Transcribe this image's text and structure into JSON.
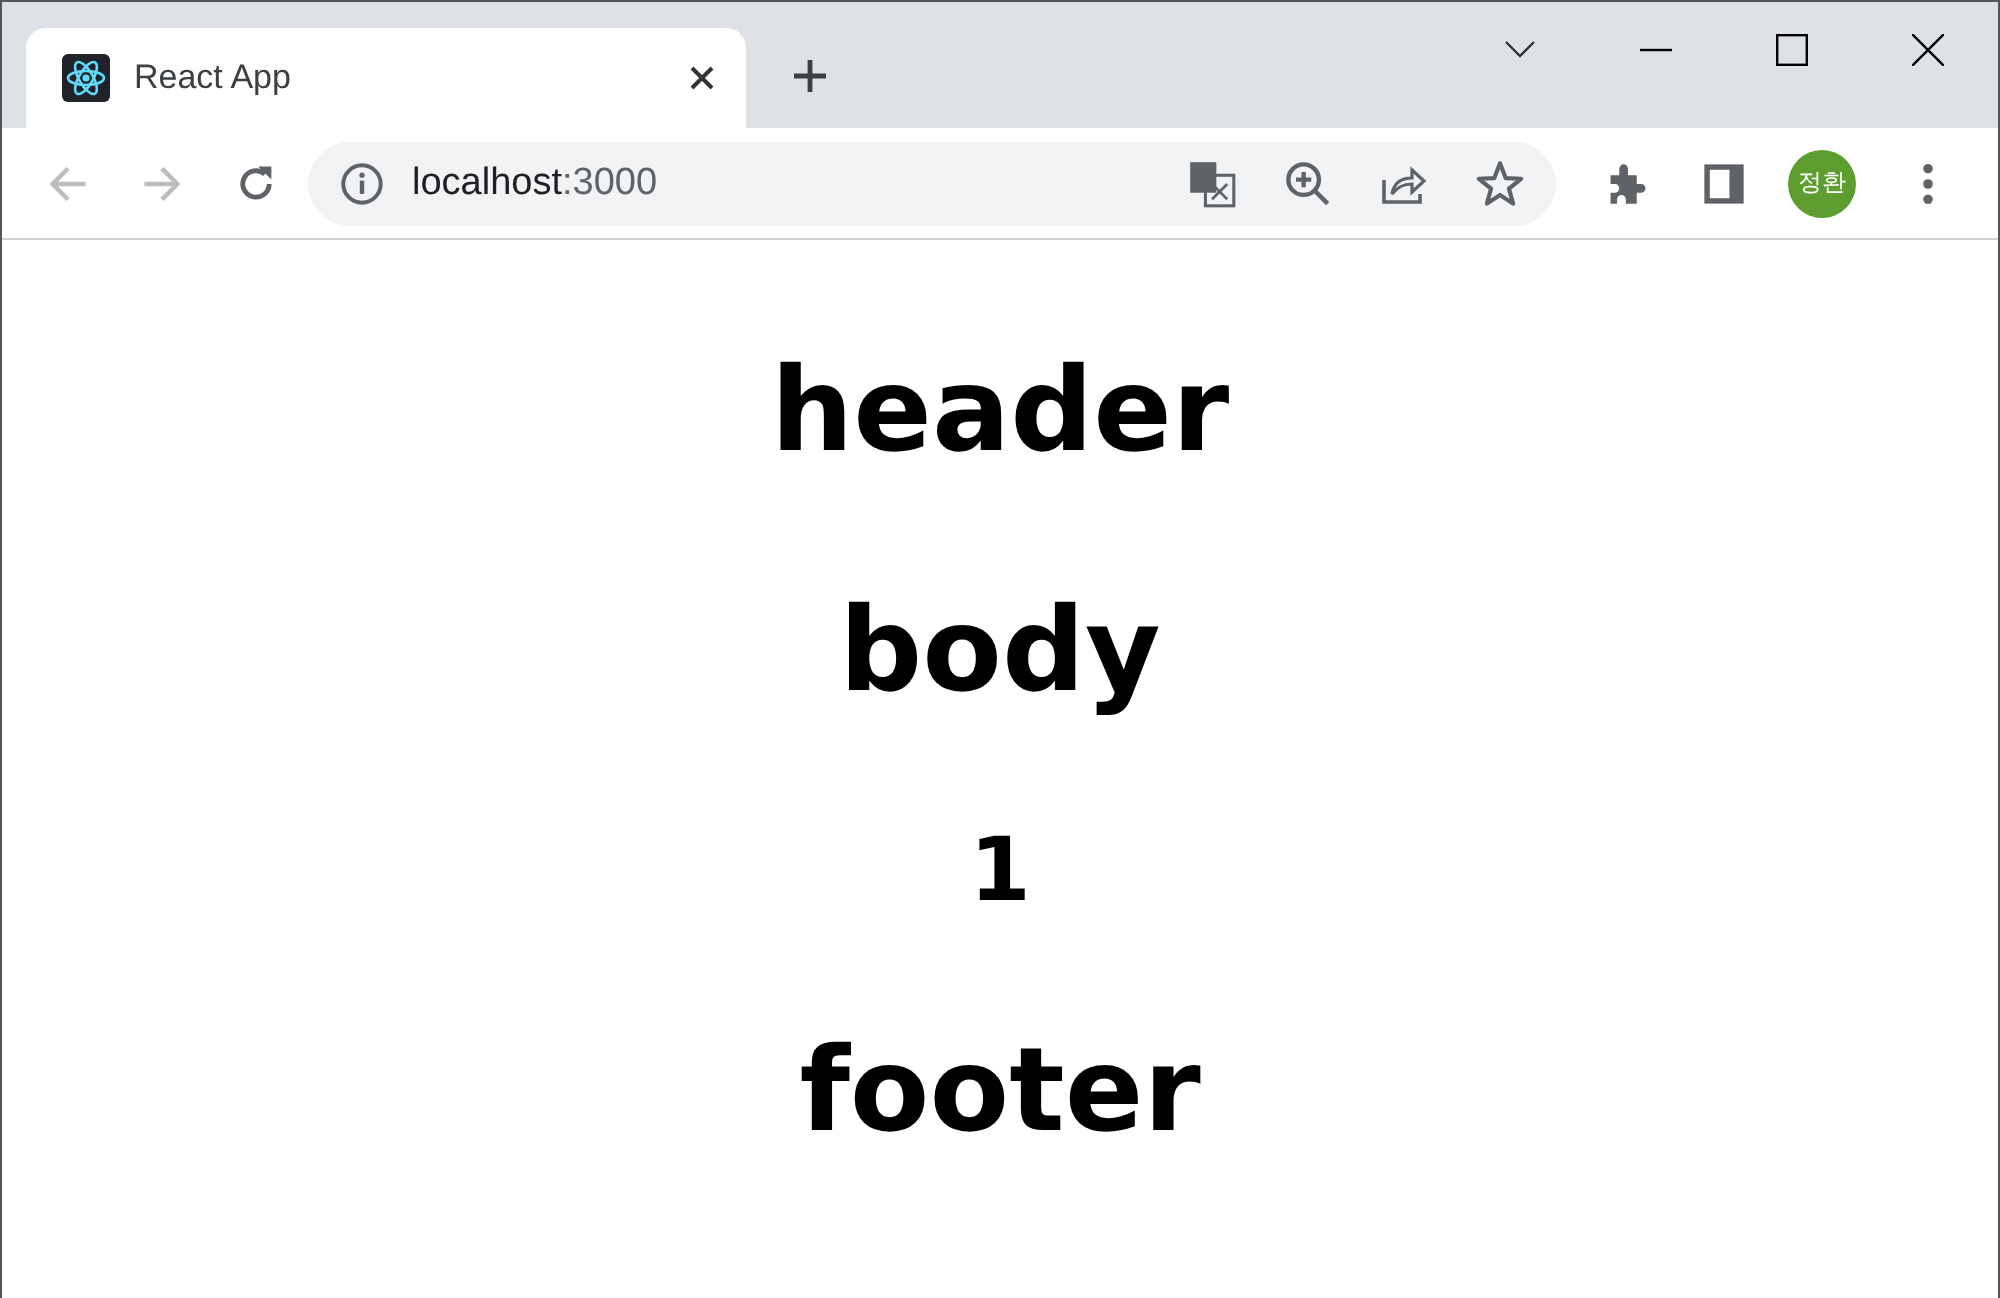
{
  "tabs": [
    {
      "title": "React App",
      "selected": true
    }
  ],
  "toolbar": {
    "back": {
      "disabled": true
    },
    "forward": {
      "disabled": true
    },
    "address": {
      "host": "localhost",
      "port": ":3000"
    },
    "profile": "정환"
  },
  "page": [
    {
      "kind": "heading",
      "text": "header"
    },
    {
      "kind": "heading",
      "text": "body"
    },
    {
      "kind": "counter",
      "text": "1"
    },
    {
      "kind": "heading",
      "text": "footer"
    }
  ]
}
